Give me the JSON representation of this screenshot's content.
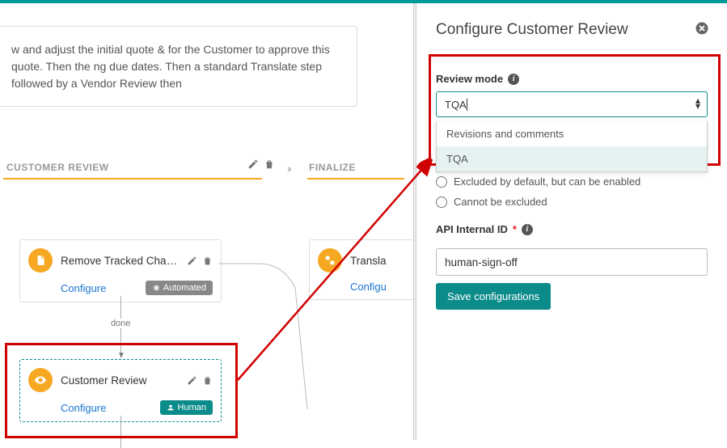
{
  "description": "w and adjust the initial quote & for the Customer to approve this quote. Then the ng due dates. Then a standard Translate step followed by a Vendor Review then",
  "phases": {
    "customer_review": "CUSTOMER REVIEW",
    "finalize": "FINALIZE"
  },
  "steps": {
    "remove_tracked": {
      "title": "Remove Tracked Chang...",
      "configure": "Configure",
      "badge": "Automated"
    },
    "customer_review": {
      "title": "Customer Review",
      "configure": "Configure",
      "badge": "Human"
    },
    "translate": {
      "title": "Transla",
      "configure": "Configu"
    },
    "connector_label": "done"
  },
  "panel": {
    "title": "Configure Customer Review",
    "review_mode_label": "Review mode",
    "review_mode_value": "TQA",
    "dropdown": {
      "opt1": "Revisions and comments",
      "opt2": "TQA"
    },
    "radio1": "Excluded by default, but can be enabled",
    "radio2": "Cannot be excluded",
    "api_label": "API Internal ID",
    "api_value": "human-sign-off",
    "save": "Save configurations"
  }
}
